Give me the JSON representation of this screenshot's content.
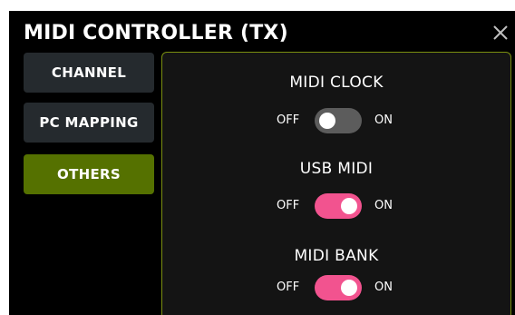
{
  "header": {
    "title": "MIDI CONTROLLER (TX)",
    "close_icon": "close-icon"
  },
  "nav": {
    "items": [
      {
        "label": "CHANNEL",
        "active": false
      },
      {
        "label": "PC MAPPING",
        "active": false
      },
      {
        "label": "OTHERS",
        "active": true
      }
    ]
  },
  "settings": [
    {
      "title": "MIDI CLOCK",
      "off_label": "OFF",
      "on_label": "ON",
      "state": "off"
    },
    {
      "title": "USB MIDI",
      "off_label": "OFF",
      "on_label": "ON",
      "state": "on"
    },
    {
      "title": "MIDI BANK",
      "off_label": "OFF",
      "on_label": "ON",
      "state": "on"
    }
  ],
  "colors": {
    "background": "#000000",
    "nav_button": "#252a2e",
    "nav_active": "#557100",
    "panel_border": "#7a8f10",
    "toggle_on": "#f2538f",
    "toggle_off": "#5c5c5c"
  }
}
